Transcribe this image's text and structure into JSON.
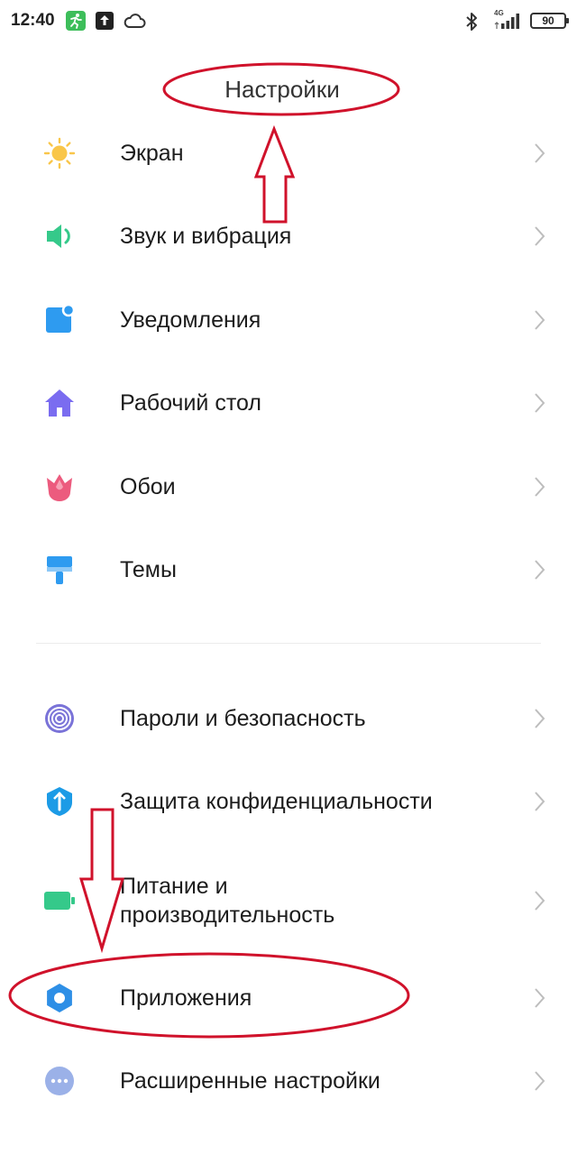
{
  "status_bar": {
    "time": "12:40",
    "network": "4G",
    "battery": "90"
  },
  "page": {
    "title": "Настройки"
  },
  "groups": [
    {
      "items": [
        {
          "label": "Экран",
          "icon": "sun-icon",
          "color": "#F9C64A"
        },
        {
          "label": "Звук и вибрация",
          "icon": "speaker-icon",
          "color": "#35C98A"
        },
        {
          "label": "Уведомления",
          "icon": "notification-icon",
          "color": "#2E9BF0"
        },
        {
          "label": "Рабочий стол",
          "icon": "home-icon",
          "color": "#7A6CF0"
        },
        {
          "label": "Обои",
          "icon": "tulip-icon",
          "color": "#EC5B7E"
        },
        {
          "label": "Темы",
          "icon": "brush-icon",
          "color": "#2E9BF0"
        }
      ]
    },
    {
      "items": [
        {
          "label": "Пароли и безопасность",
          "icon": "fingerprint-icon",
          "color": "#7A73D8"
        },
        {
          "label": "Защита конфиденциальности",
          "icon": "shield-icon",
          "color": "#1C9BE6"
        },
        {
          "label_line1": "Питание и",
          "label_line2": "производительность",
          "icon": "battery-icon",
          "color": "#35C98A"
        },
        {
          "label": "Приложения",
          "icon": "gear-icon",
          "color": "#2E8FE6"
        },
        {
          "label": "Расширенные настройки",
          "icon": "more-icon",
          "color": "#9BB1E8"
        }
      ]
    }
  ],
  "colors": {
    "annotation": "#D0122B",
    "chevron": "#BDBDBD"
  }
}
